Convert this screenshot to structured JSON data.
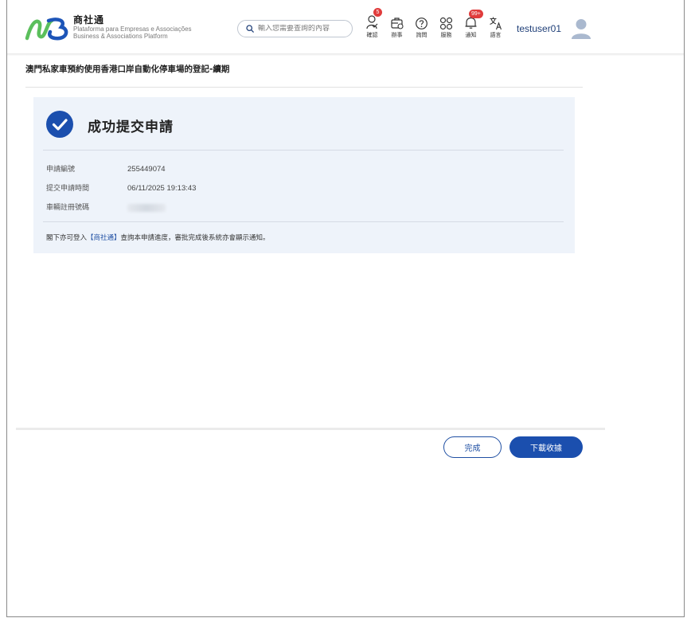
{
  "header": {
    "brand_name": "商社通",
    "brand_sub_pt": "Plataforma para Empresas e Associações",
    "brand_sub_en": "Business & Associations Platform",
    "search_placeholder": "輸入您需要查詢的內容",
    "nav": [
      {
        "label": "確認",
        "icon": "verify-icon",
        "badge": "5"
      },
      {
        "label": "辦事",
        "icon": "briefcase-icon",
        "badge": ""
      },
      {
        "label": "詢問",
        "icon": "question-icon",
        "badge": ""
      },
      {
        "label": "服務",
        "icon": "services-grid-icon",
        "badge": ""
      },
      {
        "label": "通知",
        "icon": "bell-icon",
        "badge": "99+"
      },
      {
        "label": "語言",
        "icon": "translate-icon",
        "badge": ""
      }
    ],
    "username": "testuser01"
  },
  "page": {
    "title": "澳門私家車預約使用香港口岸自動化停車場的登記-續期"
  },
  "result": {
    "status": "成功提交申請",
    "fields": [
      {
        "label": "申請編號",
        "value": "255449074"
      },
      {
        "label": "提交申請時間",
        "value": "06/11/2025 19:13:43"
      },
      {
        "label": "車輛註冊號碼",
        "value": ""
      }
    ],
    "note_before": "閣下亦可登入",
    "note_link": "【商社通】",
    "note_after": "查詢本申請進度，審批完成後系統亦會顯示通知。"
  },
  "footer": {
    "done_label": "完成",
    "download_label": "下載收據"
  },
  "colors": {
    "primary": "#1b4fae",
    "card_bg": "#eef3fa",
    "badge": "#e03c3c"
  }
}
